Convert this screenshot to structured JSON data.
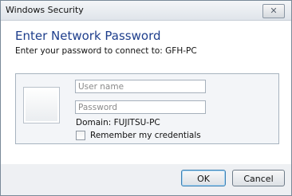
{
  "window": {
    "title": "Windows Security",
    "close_icon": "close-icon"
  },
  "header": {
    "heading": "Enter Network Password",
    "subtext": "Enter your password to connect to: GFH-PC"
  },
  "credentials": {
    "user_tile_icon": "user-tile-icon",
    "username_placeholder": "User name",
    "username_value": "",
    "password_placeholder": "Password",
    "password_value": "",
    "domain_text": "Domain: FUJITSU-PC",
    "remember_label": "Remember my credentials",
    "remember_checked": false
  },
  "buttons": {
    "ok_label": "OK",
    "cancel_label": "Cancel"
  },
  "colors": {
    "heading": "#1e3e8c",
    "dialog_bg": "#eef0f3",
    "content_bg": "#ffffff"
  }
}
